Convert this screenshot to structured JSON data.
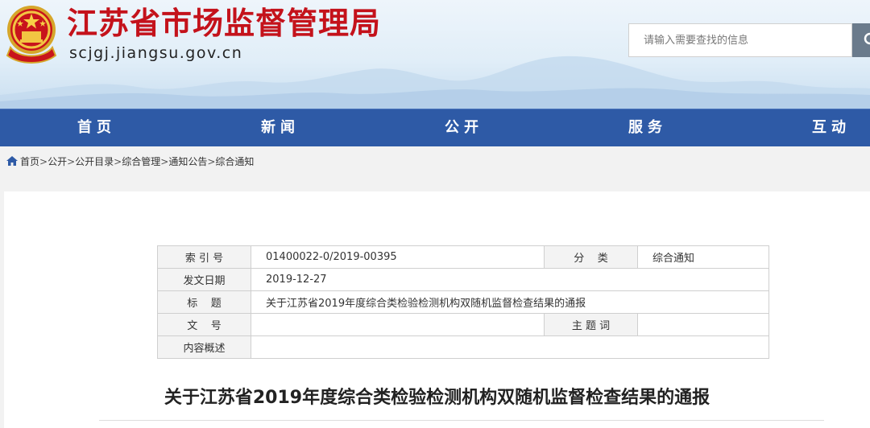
{
  "header": {
    "site_title": "江苏省市场监督管理局",
    "site_domain": "scjgj.jiangsu.gov.cn",
    "search_placeholder": "请输入需要查找的信息"
  },
  "nav": {
    "items": [
      "首页",
      "新闻",
      "公开",
      "服务",
      "互动"
    ]
  },
  "breadcrumb": {
    "items": [
      "首页",
      "公开",
      "公开目录",
      "综合管理",
      "通知公告",
      "综合通知"
    ],
    "separator": ">"
  },
  "meta_table": {
    "index_label": "索 引 号",
    "index_value": "01400022-0/2019-00395",
    "category_label": "分    类",
    "category_value": "综合通知",
    "date_label": "发文日期",
    "date_value": "2019-12-27",
    "title_label": "标    题",
    "title_value": "关于江苏省2019年度综合类检验检测机构双随机监督检查结果的通报",
    "doc_no_label": "文    号",
    "doc_no_value": "",
    "keywords_label": "主 题 词",
    "keywords_value": "",
    "summary_label": "内容概述",
    "summary_value": ""
  },
  "article": {
    "title": "关于江苏省2019年度综合类检验检测机构双随机监督检查结果的通报"
  },
  "colors": {
    "title_red": "#c4121b",
    "nav_blue": "#2e5aa6"
  }
}
